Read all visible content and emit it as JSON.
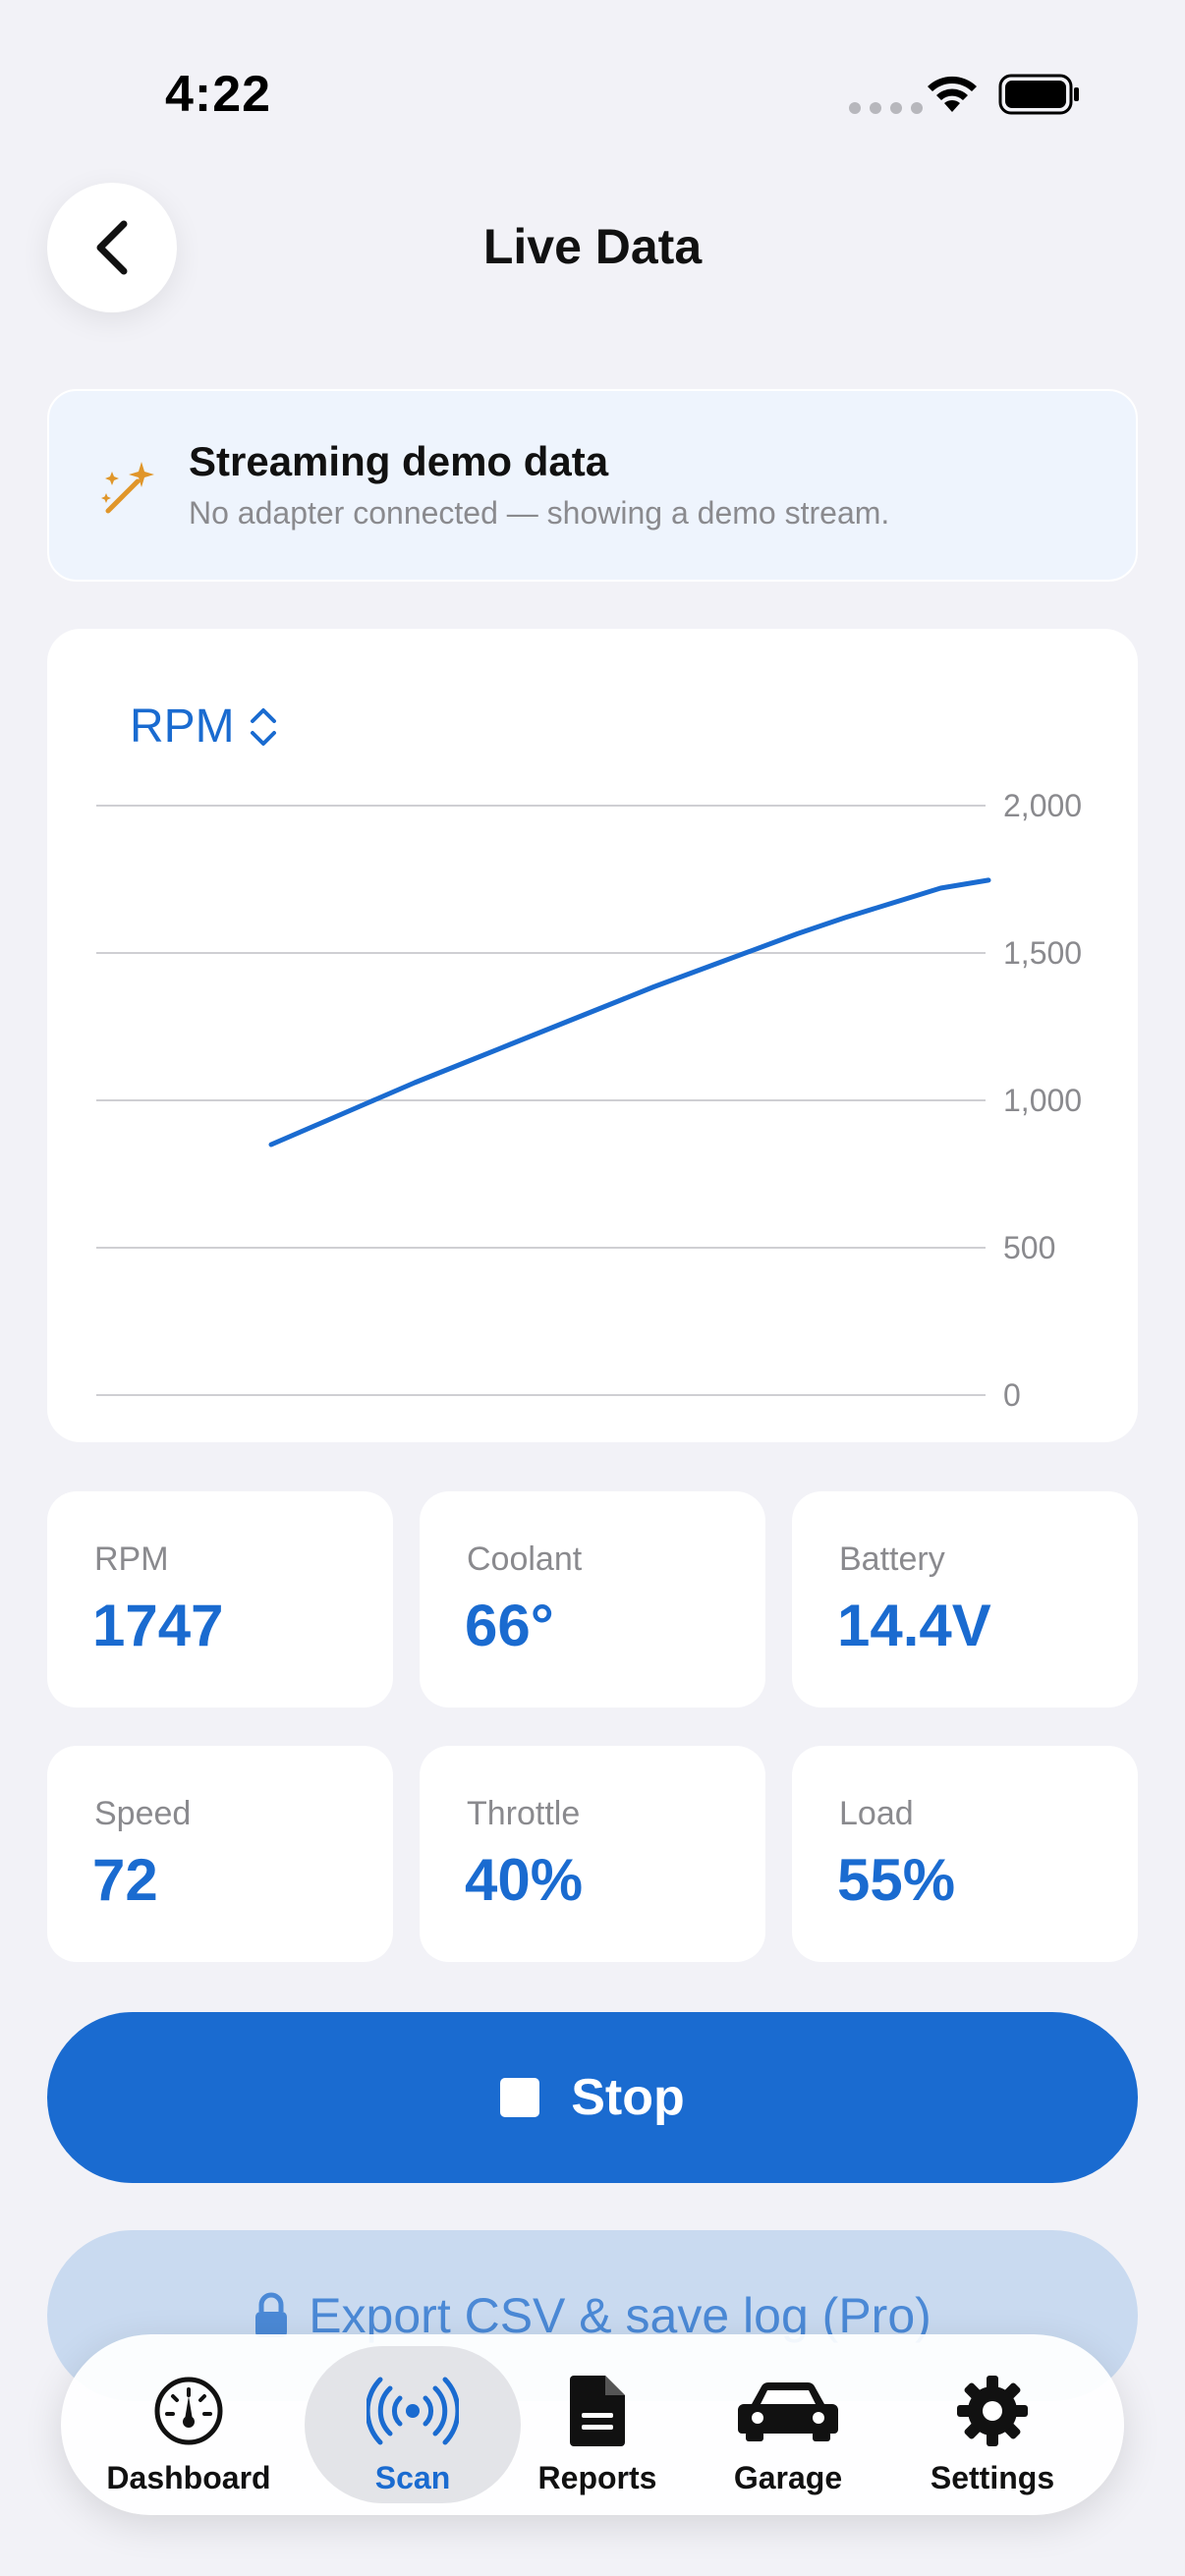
{
  "status_bar": {
    "time": "4:22"
  },
  "header": {
    "title": "Live Data"
  },
  "banner": {
    "title": "Streaming demo data",
    "subtitle": "No adapter connected — showing a demo stream."
  },
  "chart_picker": {
    "selected": "RPM"
  },
  "chart_data": {
    "type": "line",
    "title": "",
    "xlabel": "",
    "ylabel": "",
    "ylim": [
      0,
      2000
    ],
    "yticks": [
      0,
      500,
      1000,
      1500,
      2000
    ],
    "ytick_labels": [
      "0",
      "500",
      "1,000",
      "1,500",
      "2,000"
    ],
    "y_axis_side": "right",
    "grid": true,
    "series": [
      {
        "values": [
          850,
          920,
          990,
          1060,
          1125,
          1190,
          1255,
          1320,
          1385,
          1445,
          1505,
          1565,
          1620,
          1670,
          1720,
          1747
        ]
      }
    ],
    "color": "#1a6bd0"
  },
  "stats": [
    {
      "label": "RPM",
      "value": "1747"
    },
    {
      "label": "Coolant",
      "value": "66°"
    },
    {
      "label": "Battery",
      "value": "14.4V"
    },
    {
      "label": "Speed",
      "value": "72"
    },
    {
      "label": "Throttle",
      "value": "40%"
    },
    {
      "label": "Load",
      "value": "55%"
    }
  ],
  "actions": {
    "stop_label": "Stop",
    "export_label": "Export CSV & save log (Pro)"
  },
  "tabs": [
    {
      "label": "Dashboard",
      "icon": "gauge-icon"
    },
    {
      "label": "Scan",
      "icon": "antenna-icon",
      "active": true
    },
    {
      "label": "Reports",
      "icon": "document-icon"
    },
    {
      "label": "Garage",
      "icon": "car-icon"
    },
    {
      "label": "Settings",
      "icon": "gear-icon"
    }
  ],
  "colors": {
    "accent": "#1a6bd0",
    "background": "#f2f2f7",
    "banner_bg": "#eef4fd",
    "banner_icon": "#e0962a"
  }
}
